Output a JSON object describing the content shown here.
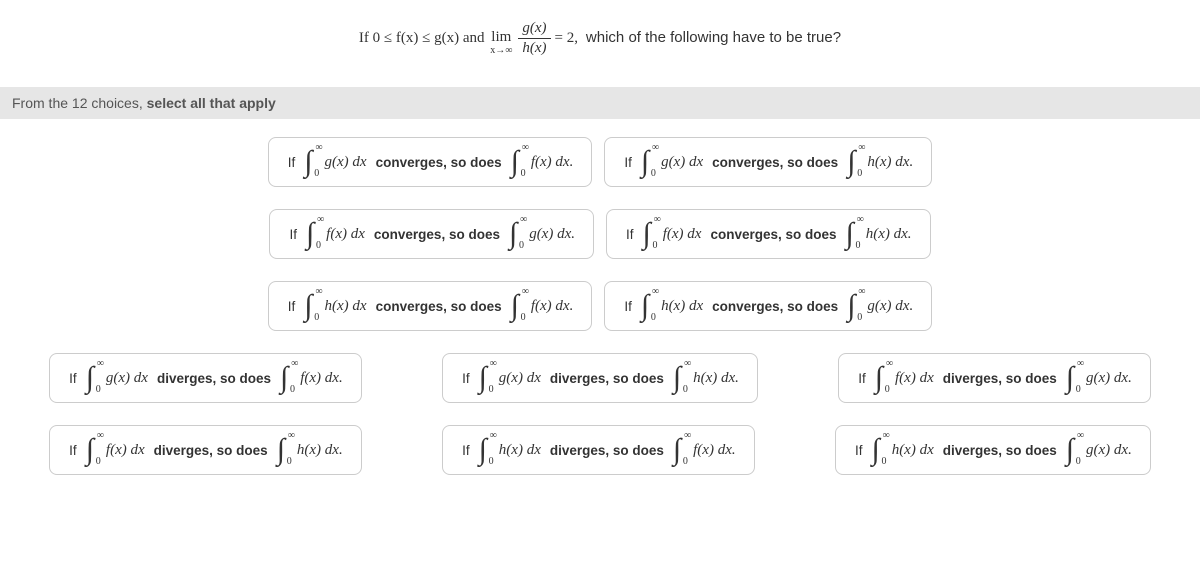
{
  "question": {
    "prefix": "If 0 ≤ f(x) ≤ g(x) and",
    "lim_top": "lim",
    "lim_bot": "x→∞",
    "frac_num": "g(x)",
    "frac_den": "h(x)",
    "equals": "= 2,",
    "suffix": "which of the following have to be true?"
  },
  "instruction": {
    "prefix": "From the 12 choices,",
    "bold": "select all that apply"
  },
  "words": {
    "if": "If",
    "converges": "converges, so does",
    "diverges": "diverges, so does"
  },
  "int": {
    "upper": "∞",
    "lower": "0",
    "g": "g(x) dx",
    "f": "f(x) dx",
    "h": "h(x) dx",
    "g_nodot": "g(x) dx.",
    "f_nodot": "f(x) dx.",
    "h_nodot": "h(x) dx."
  }
}
